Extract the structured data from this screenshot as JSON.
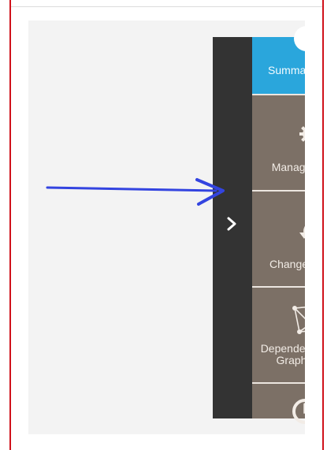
{
  "sidebar": {
    "collapse_icon": "chevron-right-icon",
    "items": [
      {
        "label": "Summary",
        "icon": "summary-icon"
      },
      {
        "label": "Manage",
        "icon": "gears-icon"
      },
      {
        "label": "Changes",
        "icon": "undo-icon"
      },
      {
        "label_line1": "Dependency",
        "label_line2": "Graph",
        "icon": "network-graph-icon"
      },
      {
        "icon": "clock-icon"
      }
    ]
  },
  "annotation": {
    "icon": "arrow-icon",
    "color": "#3344e0"
  },
  "colors": {
    "summary_bg": "#2aa6dc",
    "nav_bg": "#7c7066",
    "collapse_strip_bg": "#333333",
    "frame_border": "#d0121b"
  }
}
